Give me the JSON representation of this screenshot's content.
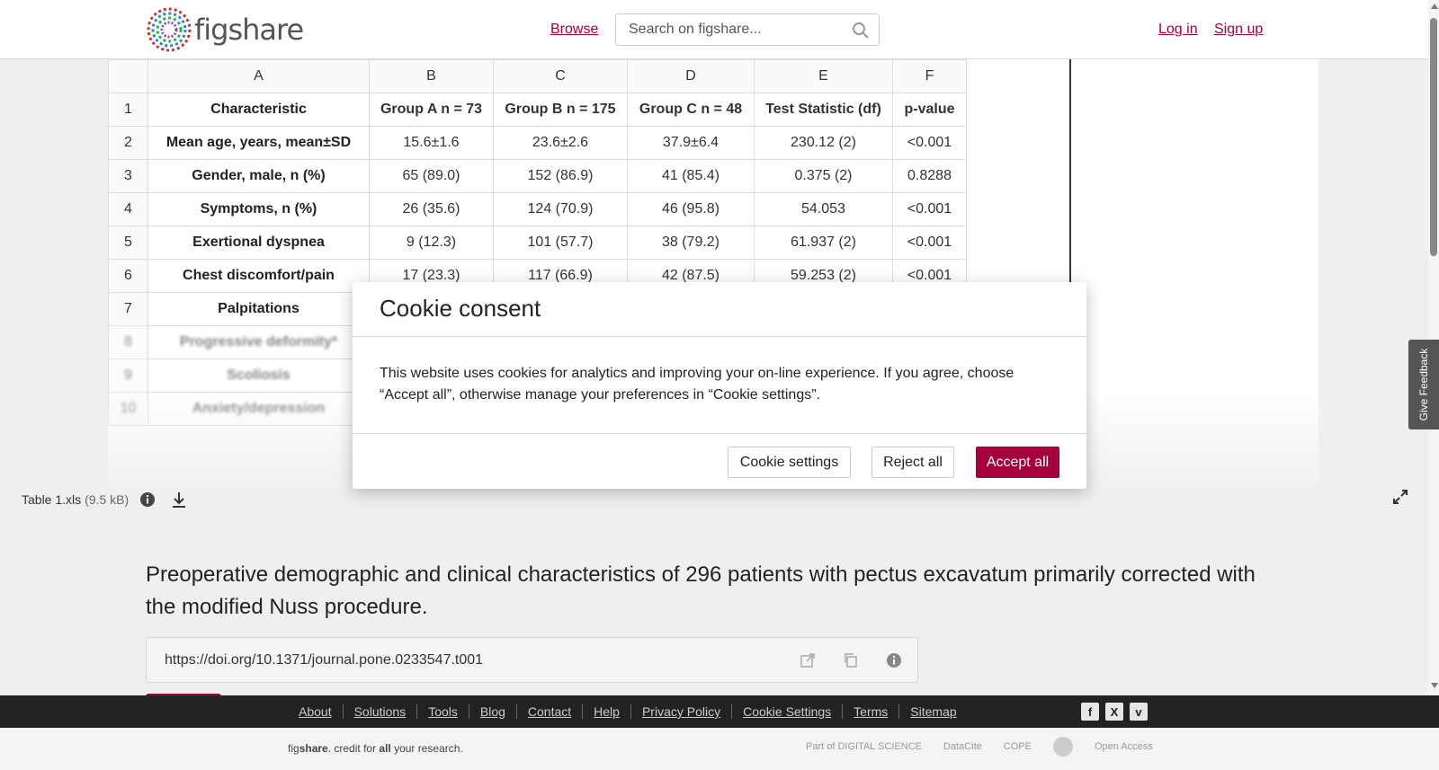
{
  "header": {
    "logo_text": "figshare",
    "browse_label": "Browse",
    "search_placeholder": "Search on figshare...",
    "login_label": "Log in",
    "signup_label": "Sign up"
  },
  "sheet": {
    "columns": [
      "A",
      "B",
      "C",
      "D",
      "E",
      "F"
    ],
    "rows": [
      {
        "num": "1",
        "cells": [
          "Characteristic",
          "Group A n = 73",
          "Group B n = 175",
          "Group C n = 48",
          "Test Statistic (df)",
          "p-value"
        ]
      },
      {
        "num": "2",
        "cells": [
          "Mean age, years, mean±SD",
          "15.6±1.6",
          "23.6±2.6",
          "37.9±6.4",
          "230.12 (2)",
          "<0.001"
        ]
      },
      {
        "num": "3",
        "cells": [
          "Gender, male, n (%)",
          "65 (89.0)",
          "152 (86.9)",
          "41 (85.4)",
          "0.375 (2)",
          "0.8288"
        ]
      },
      {
        "num": "4",
        "cells": [
          "Symptoms, n (%)",
          "26 (35.6)",
          "124 (70.9)",
          "46 (95.8)",
          "54.053",
          "<0.001"
        ]
      },
      {
        "num": "5",
        "cells": [
          "Exertional dyspnea",
          "9 (12.3)",
          "101 (57.7)",
          "38 (79.2)",
          "61.937 (2)",
          "<0.001"
        ]
      },
      {
        "num": "6",
        "cells": [
          "Chest discomfort/pain",
          "17 (23.3)",
          "117 (66.9)",
          "42 (87.5)",
          "59.253 (2)",
          "<0.001"
        ]
      },
      {
        "num": "7",
        "cells": [
          "Palpitations",
          "",
          "",
          "",
          "",
          ""
        ]
      },
      {
        "num": "8",
        "cells": [
          "Progressive deformity*",
          "",
          "",
          "",
          "",
          ""
        ]
      },
      {
        "num": "9",
        "cells": [
          "Scoliosis",
          "",
          "",
          "",
          "",
          ""
        ]
      },
      {
        "num": "10",
        "cells": [
          "Anxiety/depression",
          "",
          "",
          "",
          "",
          ""
        ]
      }
    ]
  },
  "file": {
    "name": "Table 1.xls",
    "size": "(9.5 kB)"
  },
  "item": {
    "title": "Preoperative demographic and clinical characteristics of 296 patients with pectus excavatum primarily corrected with the modified Nuss procedure.",
    "doi": "https://doi.org/10.1371/journal.pone.0233547.t001"
  },
  "cookie": {
    "title": "Cookie consent",
    "body": "This website uses cookies for analytics and improving your on-line experience. If you agree, choose “Accept all”, otherwise manage your preferences in “Cookie settings”.",
    "settings_label": "Cookie settings",
    "reject_label": "Reject all",
    "accept_label": "Accept all",
    "accent_color": "#a5003c"
  },
  "feedback_label": "Give Feedback",
  "footer": {
    "links": [
      "About",
      "Solutions",
      "Tools",
      "Blog",
      "Contact",
      "Help",
      "Privacy Policy",
      "Cookie Settings",
      "Terms",
      "Sitemap"
    ],
    "tagline_prefix": "fig",
    "tagline_brand": "share",
    "tagline_mid": ". credit for ",
    "tagline_all": "all",
    "tagline_end": " your research.",
    "partner_digital_science": "Part of DIGITAL SCIENCE",
    "partner_datacite": "DataCite",
    "partner_cope": "COPE",
    "partner_open_access": "Open Access",
    "social_icons": [
      "facebook-icon",
      "x-icon",
      "vimeo-icon"
    ]
  }
}
